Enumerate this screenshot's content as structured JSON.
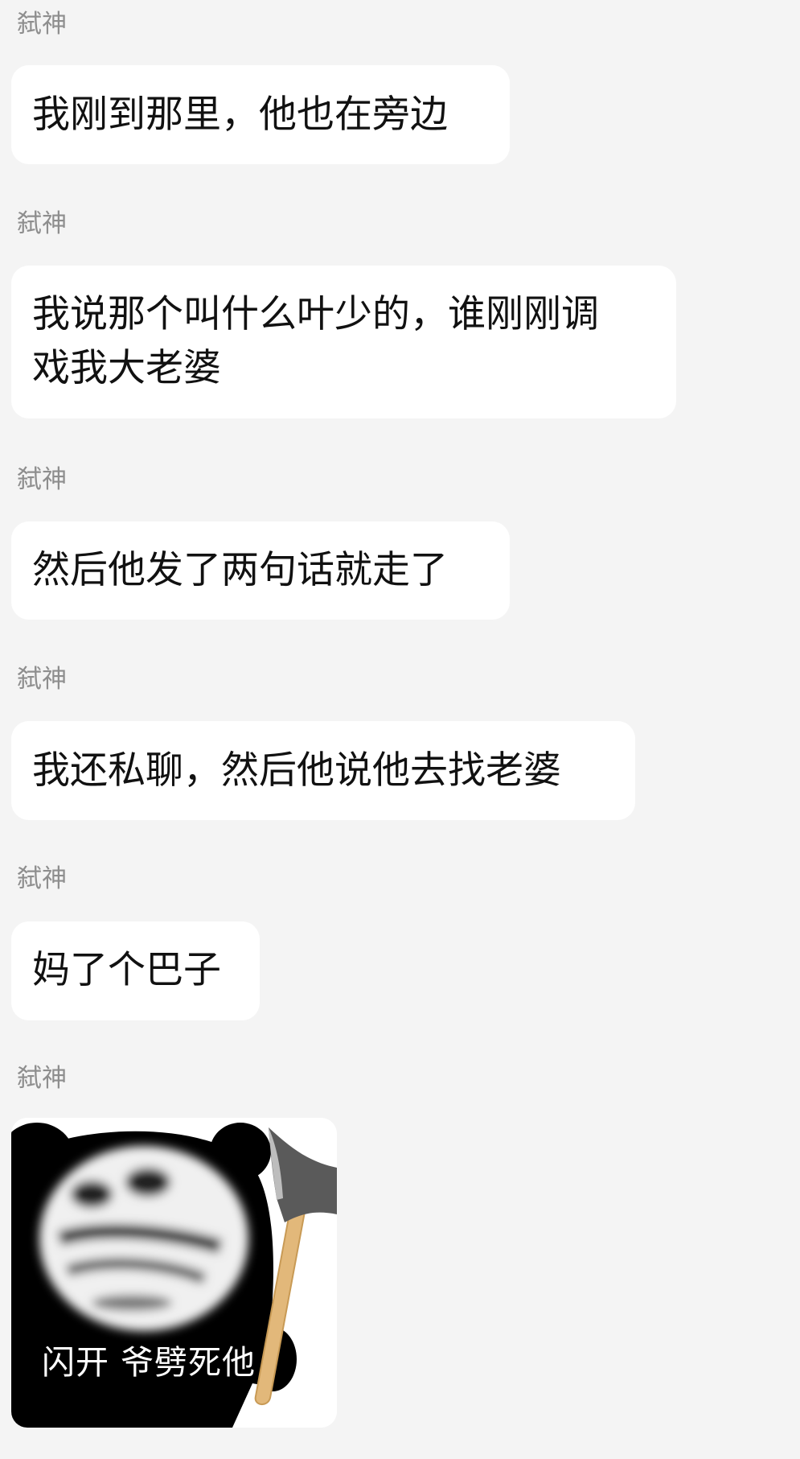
{
  "messages": [
    {
      "sender": "弑神",
      "text": "我刚到那里，他也在旁边"
    },
    {
      "sender": "弑神",
      "text": "我说那个叫什么叶少的，谁刚刚调\n戏我大老婆"
    },
    {
      "sender": "弑神",
      "text": "然后他发了两句话就走了"
    },
    {
      "sender": "弑神",
      "text": "我还私聊，然后他说他去找老婆"
    },
    {
      "sender": "弑神",
      "text": "妈了个巴子"
    },
    {
      "sender": "弑神",
      "sticker": {
        "caption": "闪开 爷劈死他",
        "icon": "panda-axe-meme"
      }
    }
  ],
  "colors": {
    "background": "#f4f4f4",
    "bubble": "#ffffff",
    "sender_text": "#8e8e8e",
    "message_text": "#111111"
  }
}
